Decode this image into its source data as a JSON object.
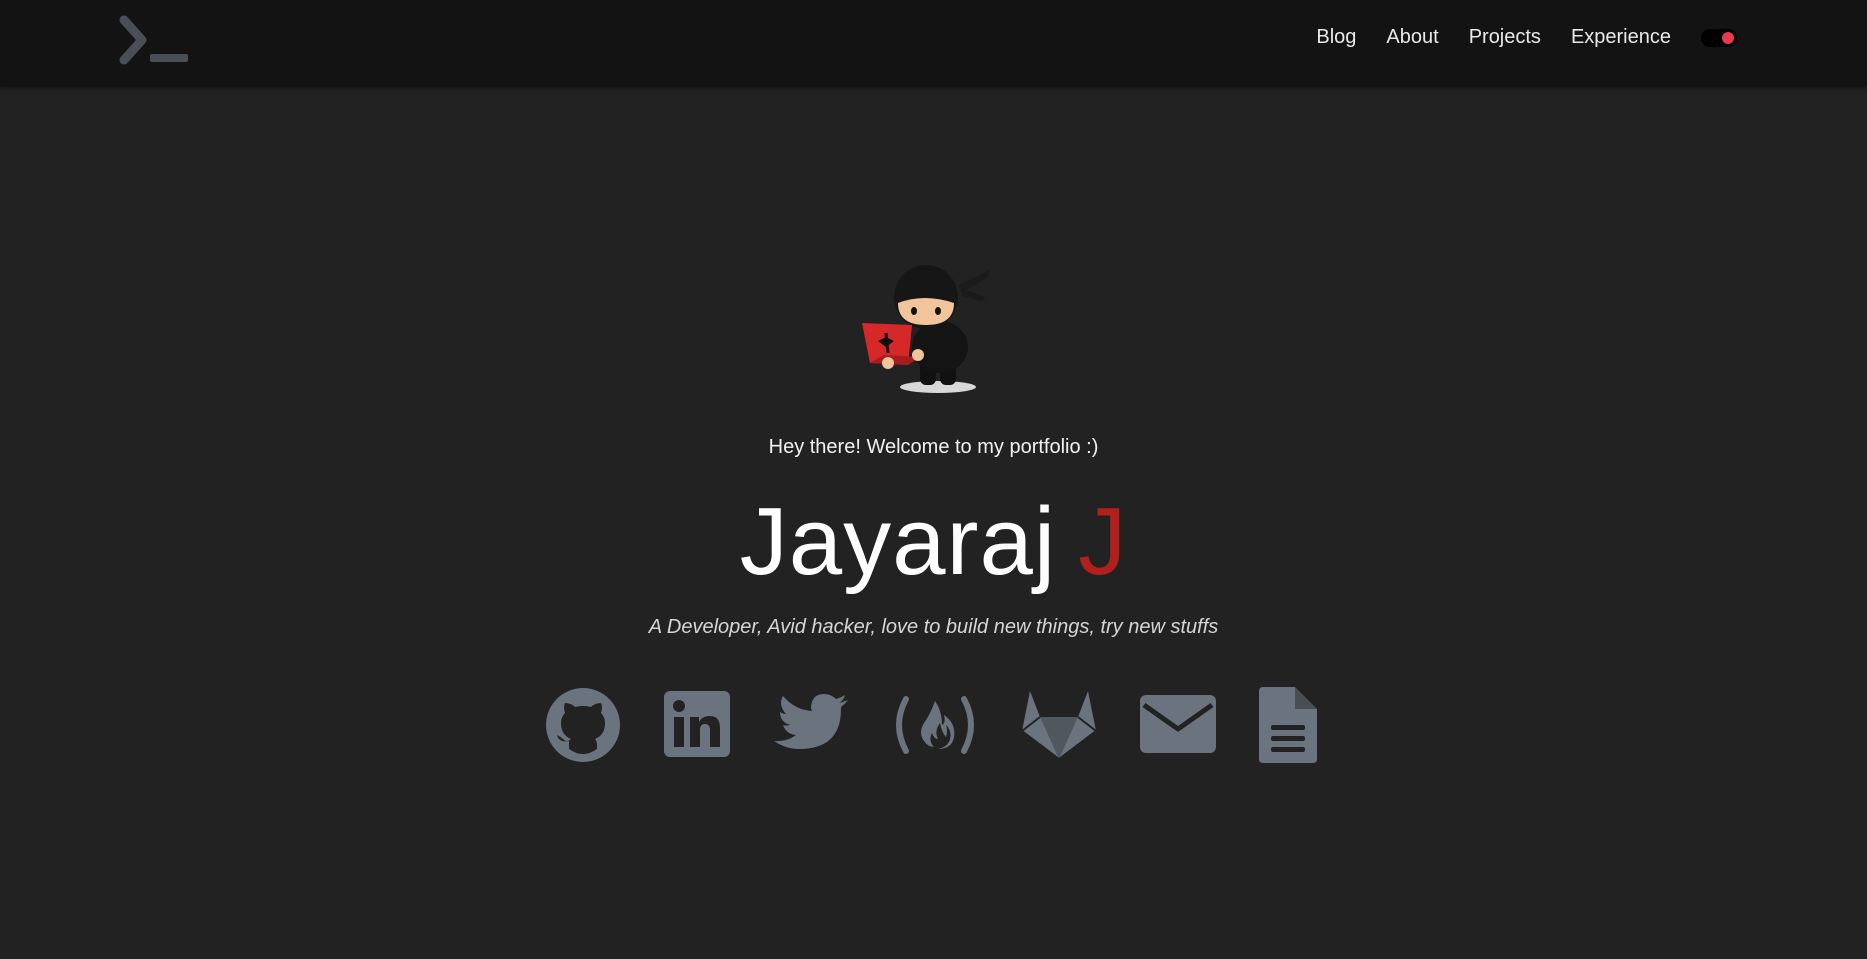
{
  "nav": {
    "logo_icon": "terminal-prompt-icon",
    "links": [
      "Blog",
      "About",
      "Projects",
      "Experience"
    ],
    "theme_toggle_color": "#e8394d"
  },
  "hero": {
    "avatar_icon": "ninja-with-laptop-illustration",
    "greeting": "Hey there! Welcome to my portfolio :)",
    "name_first": "Jayaraj",
    "name_accent": "J",
    "accent_color": "#b3201c",
    "tagline": "A Developer,  Avid hacker, love to build new things, try new stuffs"
  },
  "socials": {
    "icon_color": "#6b737f",
    "icons": [
      "github-icon",
      "linkedin-icon",
      "twitter-icon",
      "freecodecamp-icon",
      "gitlab-icon",
      "email-icon",
      "resume-document-icon"
    ]
  }
}
